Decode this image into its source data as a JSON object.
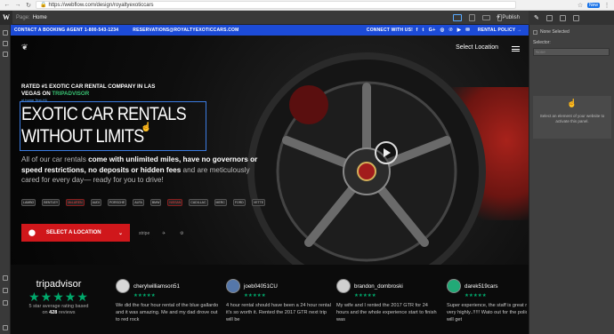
{
  "browser": {
    "url": "https://webflow.com/design/royaltyexoticcars",
    "secure_label": "Secure",
    "ext_badge": "New"
  },
  "webflow": {
    "logo": "W",
    "page_label": "Page:",
    "page_value": "Home",
    "publish_label": "Publish",
    "right_panel": {
      "none_selected": "None Selected",
      "selector_label": "Selector:",
      "selector_placeholder": "None",
      "info_message": "Select an element of your website to activate this panel."
    }
  },
  "site": {
    "topbar": {
      "booking": "CONTACT A BOOKING AGENT 1-800-543-1234",
      "email": "RESERVATIONS@ROYALTYEXOTICCARS.COM",
      "connect": "CONNECT WITH US!",
      "social_icons": [
        "facebook",
        "twitter",
        "google-plus",
        "instagram",
        "pinterest",
        "youtube",
        "email"
      ],
      "social_glyphs": [
        "f",
        "t",
        "G+",
        "◎",
        "℗",
        "▶",
        "✉"
      ],
      "policy": "RENTAL POLICY →"
    },
    "nav": {
      "select_location": "Select Location"
    },
    "hero": {
      "rated_prefix": "RATED #1 EXOTIC CAR RENTAL COMPANY IN LAS VEGAS ON ",
      "rated_brand": "TRIPADVISOR",
      "element_tag": "ul.home  Text-H1",
      "headline_line1": "EXOTIC CAR RENTALS",
      "headline_line2": "WITHOUT LIMITS",
      "para_1": "All of our car rentals ",
      "para_2": "come with unlimited miles, have no governors or speed restrictions, no deposits or hidden fees",
      "para_3": " and are meticulously cared for every day— ready for you to drive!",
      "brands": [
        "LAMBO",
        "BENTLEY",
        "McLAREN",
        "AUDI",
        "PORSCHE",
        "ALFA",
        "BMW",
        "NISSAN",
        "CADILLAC",
        "MERC",
        "FORD",
        "VETTE"
      ],
      "cta_label": "SELECT A LOCATION",
      "payments": [
        "stripe",
        "✈",
        "⚙"
      ]
    },
    "tripadvisor": {
      "logo": "tripadvisor",
      "stars": "★★★★★",
      "sub_1": "5 star average rating based",
      "sub_2_pre": "on ",
      "count": "428",
      "sub_2_post": " reviews"
    },
    "reviews": [
      {
        "name": "cherylwilliamson51",
        "stars": "★★★★★",
        "text": "We did the four hour rental of the blue gallardo and it was amazing. Me and my dad drove out to red rock"
      },
      {
        "name": "joeb04051CU",
        "stars": "★★★★★",
        "text": "4 hour rental should have been a 24 hour rental it's so worth it. Rented the 2017 GTR next trip will be"
      },
      {
        "name": "brandon_dombroski",
        "stars": "★★★★★",
        "text": "My wife and I rented the 2017 GTR for 24 hours and the whole experience start to finish was"
      },
      {
        "name": "darek519cars",
        "stars": "★★★★★",
        "text": "Super experience, the staff is great recommend very highly..!!!!! Wato out for the police... speed will get"
      }
    ]
  }
}
